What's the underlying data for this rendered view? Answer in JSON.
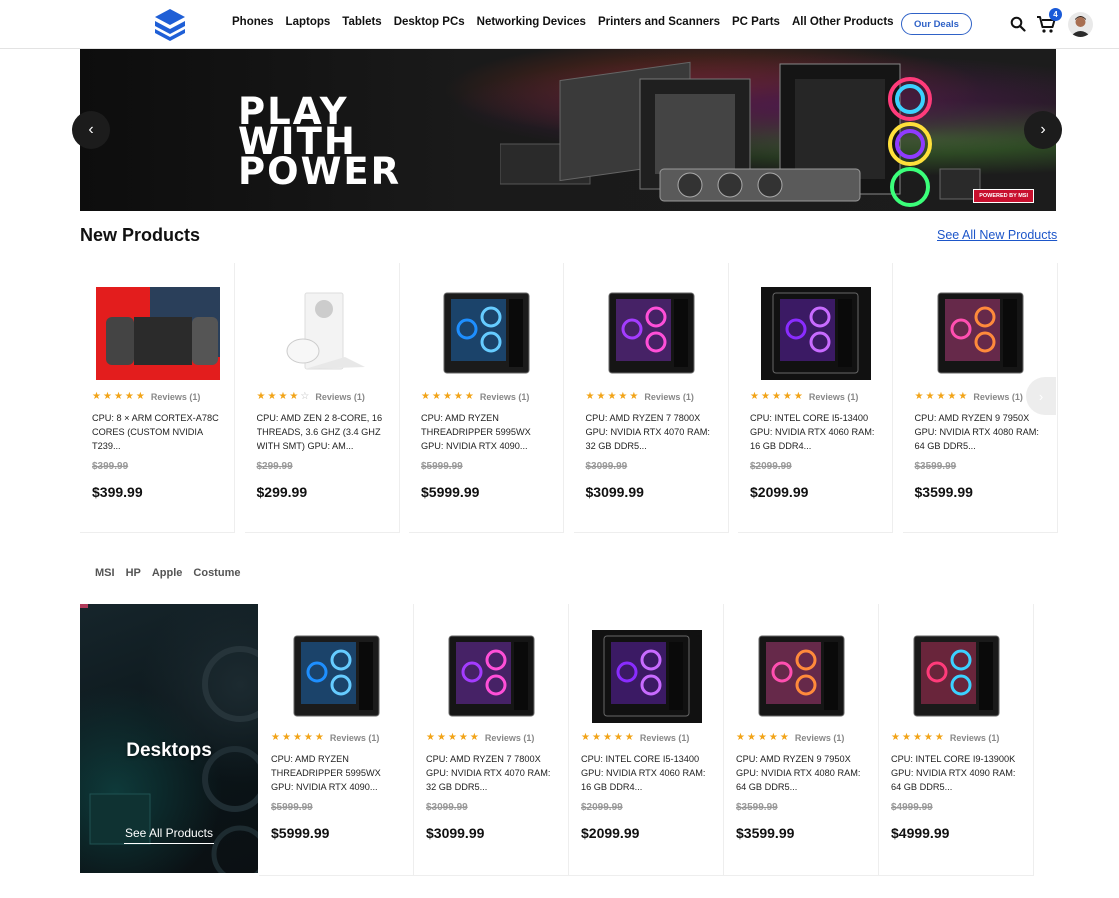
{
  "header": {
    "logo_icon": "stacked-layers-logo",
    "nav": [
      "Phones",
      "Laptops",
      "Tablets",
      "Desktop PCs",
      "Networking Devices",
      "Printers and Scanners",
      "PC Parts",
      "All Other Products"
    ],
    "deals_label": "Our Deals",
    "cart_count": "4",
    "accent_color": "#2f62c7"
  },
  "banner": {
    "line1": "PLAY",
    "line2": "WITH",
    "line3": "POWER",
    "badge": "POWERED BY MSI",
    "prev_icon": "‹",
    "next_icon": "›"
  },
  "new_products": {
    "title": "New Products",
    "see_all": "See All New Products",
    "items": [
      {
        "stars": 5,
        "reviews": "Reviews (1)",
        "specs": "CPU: 8 × ARM Cortex-A78C cores (custom NVIDIA T239...",
        "old_price": "$399.99",
        "price": "$399.99",
        "image": "game-console-handheld"
      },
      {
        "stars": 4,
        "reviews": "Reviews (1)",
        "specs": "CPU: AMD Zen 2 8-core, 16 threads, 3.6 GHz (3.4 GHz with SMT) GPU: AM...",
        "old_price": "$299.99",
        "price": "$299.99",
        "image": "white-console"
      },
      {
        "stars": 5,
        "reviews": "Reviews (1)",
        "specs": "CPU: AMD Ryzen Threadripper 5995WX GPU: NVIDIA RTX 4090...",
        "old_price": "$5999.99",
        "price": "$5999.99",
        "image": "blue-pc-case"
      },
      {
        "stars": 5,
        "reviews": "Reviews (1)",
        "specs": "CPU: AMD Ryzen 7 7800X GPU: NVIDIA RTX 4070 RAM: 32 GB DDR5...",
        "old_price": "$3099.99",
        "price": "$3099.99",
        "image": "purple-pc-case"
      },
      {
        "stars": 5,
        "reviews": "Reviews (1)",
        "specs": "CPU: Intel Core i5-13400 GPU: NVIDIA RTX 4060 RAM: 16 GB DDR4...",
        "old_price": "$2099.99",
        "price": "$2099.99",
        "image": "violet-pc-case"
      },
      {
        "stars": 5,
        "reviews": "Reviews (1)",
        "specs": "CPU: AMD Ryzen 9 7950X GPU: NVIDIA RTX 4080 RAM: 64 GB DDR5...",
        "old_price": "$3599.99",
        "price": "$3599.99",
        "image": "pink-pc-case"
      }
    ]
  },
  "brands": [
    "MSI",
    "HP",
    "Apple",
    "Costume"
  ],
  "category": {
    "title": "Desktops",
    "link": "See All Products",
    "items": [
      {
        "stars": 5,
        "reviews": "Reviews (1)",
        "specs": "CPU: AMD Ryzen Threadripper 5995WX GPU: NVIDIA RTX 4090...",
        "old_price": "$5999.99",
        "price": "$5999.99",
        "image": "blue-pc-case"
      },
      {
        "stars": 5,
        "reviews": "Reviews (1)",
        "specs": "CPU: AMD Ryzen 7 7800X GPU: NVIDIA RTX 4070 RAM: 32 GB DDR5...",
        "old_price": "$3099.99",
        "price": "$3099.99",
        "image": "purple-pc-case"
      },
      {
        "stars": 5,
        "reviews": "Reviews (1)",
        "specs": "CPU: Intel Core i5-13400 GPU: NVIDIA RTX 4060 RAM: 16 GB DDR4...",
        "old_price": "$2099.99",
        "price": "$2099.99",
        "image": "violet-pc-case"
      },
      {
        "stars": 5,
        "reviews": "Reviews (1)",
        "specs": "CPU: AMD Ryzen 9 7950X GPU: NVIDIA RTX 4080 RAM: 64 GB DDR5...",
        "old_price": "$3599.99",
        "price": "$3599.99",
        "image": "pink-pc-case"
      },
      {
        "stars": 5,
        "reviews": "Reviews (1)",
        "specs": "CPU: Intel Core i9-13900K GPU: NVIDIA RTX 4090 RAM: 64 GB DDR5...",
        "old_price": "$4999.99",
        "price": "$4999.99",
        "image": "rgb-pc-case"
      }
    ]
  }
}
